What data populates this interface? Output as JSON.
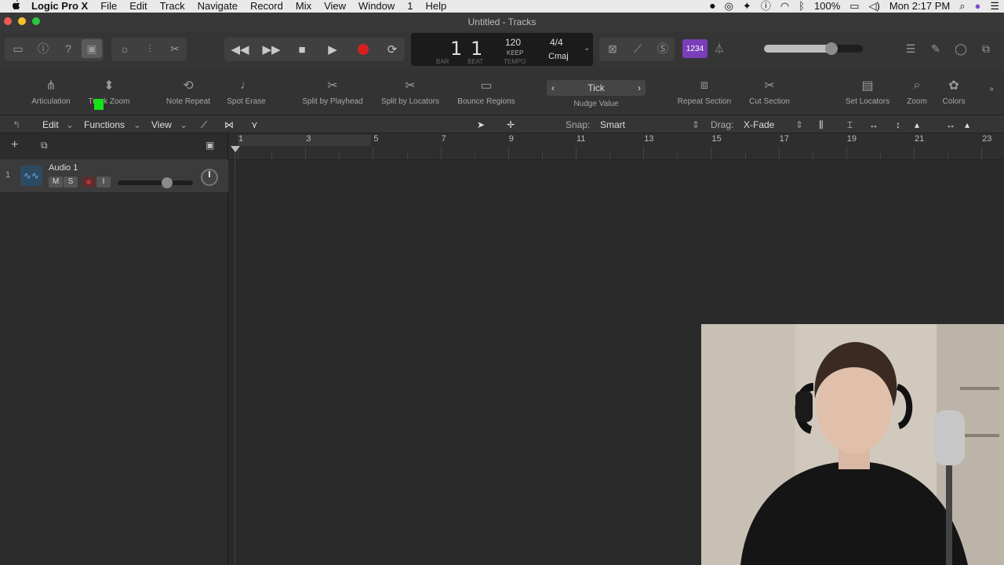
{
  "menubar": {
    "app": "Logic Pro X",
    "items": [
      "File",
      "Edit",
      "Track",
      "Navigate",
      "Record",
      "Mix",
      "View",
      "Window",
      "1",
      "Help"
    ],
    "battery": "100%",
    "clock": "Mon 2:17 PM"
  },
  "window": {
    "title": "Untitled - Tracks"
  },
  "lcd": {
    "bar": "1",
    "beat": "1",
    "bar_label": "BAR",
    "beat_label": "BEAT",
    "tempo": "120",
    "tempo_mode": "KEEP",
    "tempo_label": "TEMPO",
    "time_sig": "4/4",
    "key": "Cmaj"
  },
  "controlbar": {
    "count_in_label": "1234"
  },
  "toolbar": {
    "tools": [
      "Articulation",
      "Track Zoom",
      "Note Repeat",
      "Spot Erase",
      "Split by Playhead",
      "Split by Locators",
      "Bounce Regions",
      "Nudge Value",
      "Repeat Section",
      "Cut Section",
      "Set Locators",
      "Zoom",
      "Colors"
    ],
    "nudge_value": "Tick"
  },
  "localbar": {
    "edit": "Edit",
    "functions": "Functions",
    "view": "View",
    "snap_label": "Snap:",
    "snap_value": "Smart",
    "drag_label": "Drag:",
    "drag_value": "X-Fade"
  },
  "track": {
    "number": "1",
    "name": "Audio 1",
    "mute": "M",
    "solo": "S",
    "input": "I"
  },
  "ruler": {
    "bars": [
      "1",
      "3",
      "5",
      "7",
      "9",
      "11",
      "13",
      "15",
      "17",
      "19",
      "21",
      "23"
    ]
  },
  "colors": {
    "record": "#d62020",
    "count_in": "#7a3fb8",
    "accent": "#16e016"
  }
}
